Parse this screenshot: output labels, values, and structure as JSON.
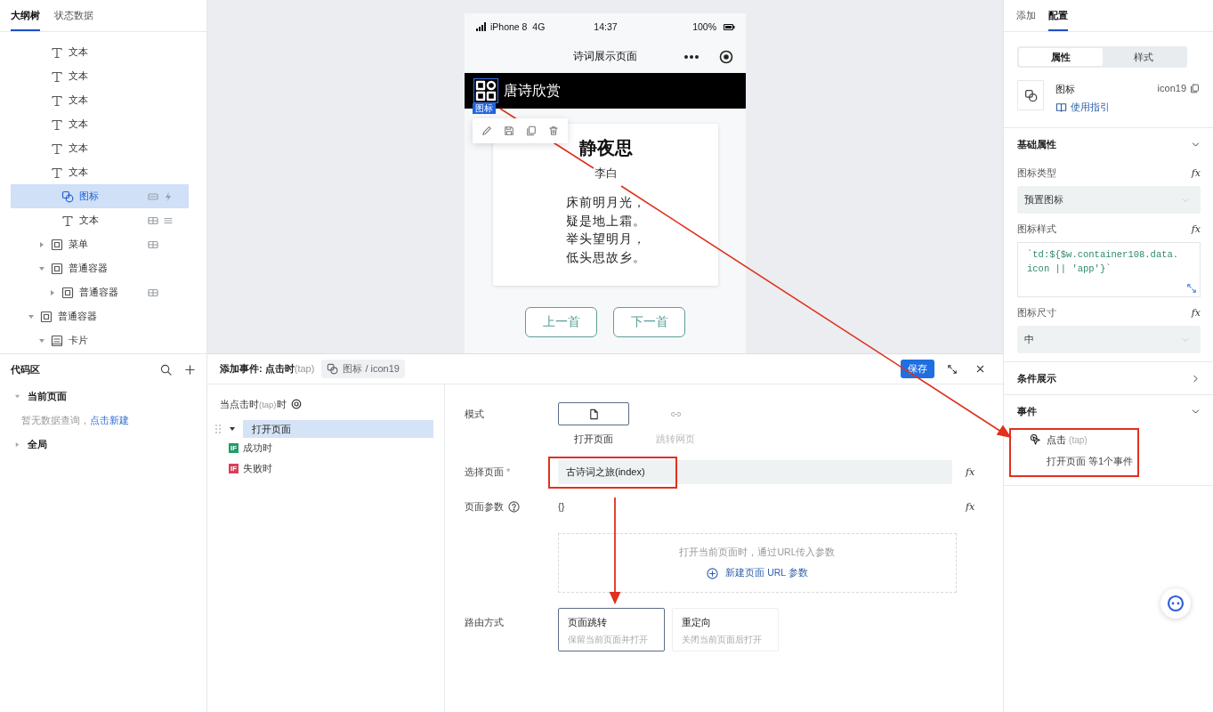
{
  "outline_panel": {
    "tabs": [
      {
        "label": "大纲树",
        "selected": true
      },
      {
        "label": "状态数据",
        "selected": false
      }
    ],
    "tree": [
      {
        "children": [
          {
            "label": "文本",
            "kind": "text",
            "selected": false
          },
          {
            "label": "文本",
            "kind": "text",
            "selected": false
          },
          {
            "label": "文本",
            "kind": "text",
            "selected": false
          },
          {
            "label": "文本",
            "kind": "text",
            "selected": false
          },
          {
            "label": "文本",
            "kind": "text",
            "selected": false
          },
          {
            "label": "文本",
            "kind": "text",
            "selected": false,
            "children": [
              {
                "label": "图标",
                "kind": "icon",
                "selected": true,
                "bound": true,
                "has_events": true
              },
              {
                "label": "文本",
                "kind": "text",
                "selected": false,
                "data_bound": true,
                "has_style": true
              }
            ]
          },
          {
            "label": "菜单",
            "kind": "container",
            "selected": false,
            "expanded": false,
            "data_bound": true
          },
          {
            "label": "普通容器",
            "kind": "container",
            "selected": false,
            "expanded": true,
            "children": [
              {
                "label": "普通容器",
                "kind": "container",
                "selected": false,
                "expanded": false,
                "data_bound": true
              }
            ]
          }
        ]
      },
      {
        "label": "普通容器",
        "kind": "container",
        "selected": false,
        "expanded": true,
        "children": [
          {
            "label": "卡片",
            "kind": "card",
            "selected": false,
            "expanded": true
          }
        ]
      }
    ]
  },
  "code_panel": {
    "title": "代码区",
    "groups": [
      {
        "label": "当前页面",
        "expanded": true,
        "empty_text": "暂无数据查询，",
        "action": "点击新建"
      },
      {
        "label": "全局",
        "expanded": false
      }
    ]
  },
  "canvas": {
    "phone": {
      "carrier": "iPhone 8  4G",
      "time": "14:37",
      "battery": "100%",
      "nav_title": "诗词展示页面",
      "header_title": "唐诗欣赏",
      "selection_tag": "图标",
      "poem": {
        "title": "静夜思",
        "author": "李白",
        "lines": [
          "床前明月光，",
          "疑是地上霜。",
          "举头望明月，",
          "低头思故乡。"
        ]
      },
      "buttons": [
        "上一首",
        "下一首"
      ]
    }
  },
  "event_editor": {
    "title": "添加事件: 点击时",
    "title_hint": "(tap)",
    "target": "图标 / icon19",
    "save": "保存",
    "trigger": {
      "label": "当点击时",
      "hint": "(tap)",
      "suffix": "时"
    },
    "actions": [
      {
        "label": "打开页面",
        "selected": true,
        "expanded": true,
        "branches": [
          {
            "tag": "IF",
            "label": "成功时",
            "color": "#1e9e6a"
          },
          {
            "tag": "IF",
            "label": "失败时",
            "color": "#d8405a"
          }
        ]
      }
    ],
    "form": {
      "mode": {
        "label": "模式",
        "options": [
          {
            "kind": "page",
            "label": "打开页面",
            "selected": true
          },
          {
            "kind": "link",
            "label": "跳转网页",
            "selected": false
          }
        ]
      },
      "page": {
        "label": "选择页面",
        "required_mark": "*",
        "value": "古诗词之旅(index)",
        "fx": "fx"
      },
      "params": {
        "label": "页面参数",
        "value": "{}",
        "fx": "fx",
        "hint": "打开当前页面时，通过URL传入参数",
        "action": "新建页面 URL 参数"
      },
      "route": {
        "label": "路由方式",
        "options": [
          {
            "title": "页面跳转",
            "desc": "保留当前页面并打开",
            "selected": true
          },
          {
            "title": "重定向",
            "desc": "关闭当前页面后打开",
            "selected": false
          }
        ]
      }
    }
  },
  "config_panel": {
    "tabs": [
      {
        "label": "添加",
        "selected": false
      },
      {
        "label": "配置",
        "selected": true
      }
    ],
    "segments": [
      {
        "label": "属性",
        "selected": true
      },
      {
        "label": "样式",
        "selected": false
      }
    ],
    "component": {
      "name": "图标",
      "guide": "使用指引",
      "id": "icon19"
    },
    "sections": [
      {
        "title": "基础属性",
        "expanded": true,
        "fields": [
          {
            "kind": "select",
            "label": "图标类型",
            "fx": "fx",
            "value": "预置图标"
          },
          {
            "kind": "code",
            "label": "图标样式",
            "fx": "fx",
            "value": "`td:${$w.container108.data.icon || 'app'}`"
          },
          {
            "kind": "select",
            "label": "图标尺寸",
            "fx": "fx",
            "value": "中"
          }
        ]
      },
      {
        "title": "条件展示",
        "expanded": false
      },
      {
        "title": "事件",
        "expanded": true,
        "events": [
          {
            "name": "点击",
            "hint": "(tap)",
            "summary": "打开页面 等1个事件"
          }
        ]
      }
    ]
  }
}
